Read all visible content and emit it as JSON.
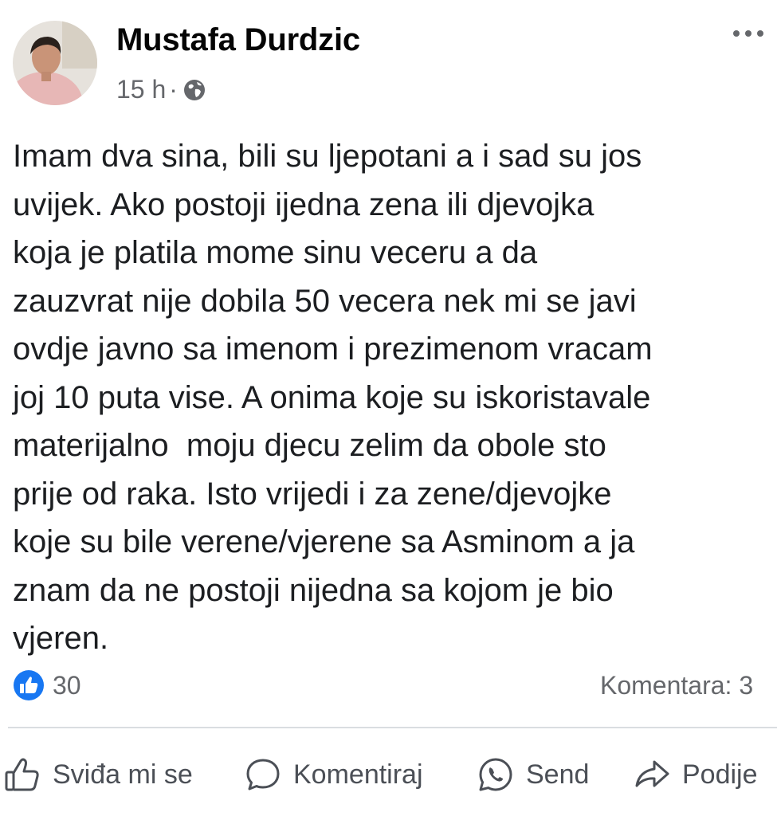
{
  "post": {
    "author": "Mustafa Durdzic",
    "time": "15 h",
    "separator": "·",
    "privacy_icon": "globe-icon",
    "more_icon": "more-options-icon",
    "text": "Imam dva sina, bili su ljepotani a i sad su jos\nuvijek. Ako postoji ijedna zena ili djevojka\nkoja je platila mome sinu veceru a da\nzauzvrat nije dobila 50 vecera nek mi se javi\novdje javno sa imenom i prezimenom vracam\njoj 10 puta vise. A onima koje su iskoristavale\nmaterijalno  moju djecu zelim da obole sto\nprije od raka. Isto vrijedi i za zene/djevojke\nkoje su bile verene/vjerene sa Asminom a ja\nznam da ne postoji nijedna sa kojom je bio\nvjeren."
  },
  "stats": {
    "reactions": "30",
    "comments": "Komentara: 3"
  },
  "actions": {
    "like": "Sviđa mi se",
    "comment": "Komentiraj",
    "send": "Send",
    "share": "Podije"
  },
  "colors": {
    "like_blue": "#1877f2",
    "text_primary": "#050505",
    "text_secondary": "#65676b",
    "divider": "#dadde1"
  }
}
